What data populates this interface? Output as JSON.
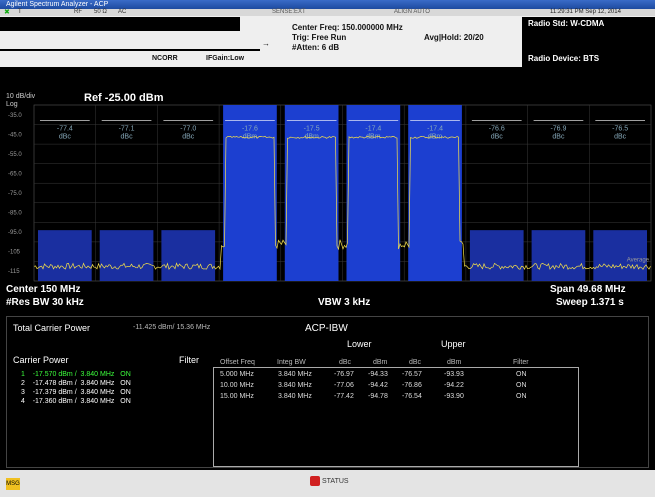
{
  "app": {
    "title": "Agilent Spectrum Analyzer - ACP"
  },
  "header": {
    "sense": "SENSE:EXT",
    "align": "ALIGN AUTO",
    "datetime": "11:29:31 PM Sep 12, 2014",
    "center_freq": "Center Freq: 150.000000 MHz",
    "trig": "Trig: Free Run",
    "atten": "#Atten: 6 dB",
    "avg_hold": "Avg|Hold: 20/20",
    "ncorr": "NCORR",
    "ifgain": "IFGain:Low",
    "radio_std": "Radio Std: W-CDMA",
    "radio_device": "Radio Device: BTS",
    "tabs": [
      "T",
      "RF",
      "50 Ω",
      "AC"
    ]
  },
  "plot": {
    "scale": "10 dB/div",
    "log": "Log",
    "ref": "Ref -25.00 dBm",
    "y_ticks": [
      "-35.0",
      "-45.0",
      "-55.0",
      "-65.0",
      "-75.0",
      "-85.0",
      "-95.0",
      "-105",
      "-115"
    ],
    "average_label": "Average",
    "bands": [
      {
        "value": "-77.4",
        "unit": "dBc"
      },
      {
        "value": "-77.1",
        "unit": "dBc"
      },
      {
        "value": "-77.0",
        "unit": "dBc"
      },
      {
        "value": "-17.6",
        "unit": "dBm"
      },
      {
        "value": "-17.5",
        "unit": "dBm"
      },
      {
        "value": "-17.4",
        "unit": "dBm"
      },
      {
        "value": "-17.4",
        "unit": "dBm"
      },
      {
        "value": "-76.6",
        "unit": "dBc"
      },
      {
        "value": "-76.9",
        "unit": "dBc"
      },
      {
        "value": "-76.5",
        "unit": "dBc"
      }
    ]
  },
  "footer": {
    "center": "Center  150 MHz",
    "res_bw": "#Res BW  30 kHz",
    "vbw": "VBW  3 kHz",
    "span": "Span 49.68 MHz",
    "sweep": "Sweep  1.371 s"
  },
  "results": {
    "total_carrier_power_label": "Total Carrier Power",
    "total_carrier_power_value": "-11.425 dBm/ 15.36 MHz",
    "mode": "ACP-IBW",
    "carrier_power_label": "Carrier Power",
    "filter_label": "Filter",
    "carriers": [
      {
        "n": "1",
        "power": "-17.570 dBm /",
        "bw": "3.840 MHz",
        "filter": "ON"
      },
      {
        "n": "2",
        "power": "-17.478 dBm /",
        "bw": "3.840 MHz",
        "filter": "ON"
      },
      {
        "n": "3",
        "power": "-17.379 dBm /",
        "bw": "3.840 MHz",
        "filter": "ON"
      },
      {
        "n": "4",
        "power": "-17.360 dBm /",
        "bw": "3.840 MHz",
        "filter": "ON"
      }
    ],
    "table": {
      "lower": "Lower",
      "upper": "Upper",
      "columns": [
        "Offset Freq",
        "Integ BW",
        "dBc",
        "dBm",
        "dBc",
        "dBm",
        "Filter"
      ],
      "rows": [
        [
          "5.000 MHz",
          "3.840 MHz",
          "-76.97",
          "-94.33",
          "-76.57",
          "-93.93",
          "ON"
        ],
        [
          "10.00 MHz",
          "3.840 MHz",
          "-77.06",
          "-94.42",
          "-76.86",
          "-94.22",
          "ON"
        ],
        [
          "15.00 MHz",
          "3.840 MHz",
          "-77.42",
          "-94.78",
          "-76.54",
          "-93.90",
          "ON"
        ]
      ]
    }
  },
  "statusbar": {
    "msg": "MSG",
    "status": "STATUS"
  }
}
